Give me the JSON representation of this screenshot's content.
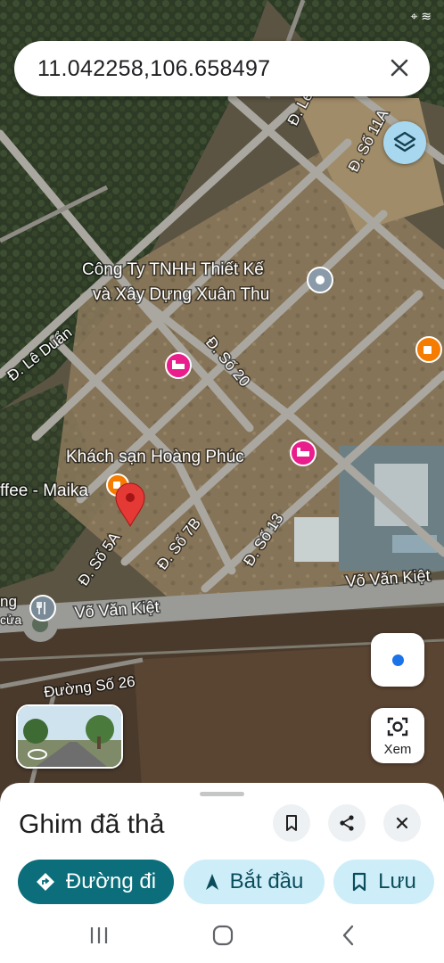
{
  "search": {
    "query": "11.042258,106.658497"
  },
  "map": {
    "labels": {
      "company": [
        "Công Ty TNHH Thiết Kế",
        "và Xây Dựng Xuân Thu"
      ],
      "hotel": "Khách sạn Hoàng Phúc",
      "cafe": "ffee - Maika",
      "restaurant": [
        "ng",
        "cửa"
      ],
      "roads": {
        "le_duan": "Đ. Lê Duẩn",
        "le_top": "Đ. Lê",
        "so_11a": "Đ. Số 11A",
        "so_20": "Đ. Số 20",
        "so_5a": "Đ. Số 5A",
        "so_7b": "Đ. Số 7B",
        "so_13": "Đ. Số 13",
        "vo_van_kiet_right": "Võ Văn Kiệt",
        "vo_van_kiet_left": "Võ Văn Kiệt",
        "duong_so_26": "Đường Số 26"
      }
    },
    "pin_color": "#e53935",
    "hotel_icon_color": "#e91e8c",
    "cafe_icon_color": "#f57c00",
    "location_dot_color": "#1a73e8",
    "xem_label": "Xem"
  },
  "sheet": {
    "title": "Ghim đã thả",
    "directions_label": "Đường đi",
    "start_label": "Bắt đầu",
    "save_label": "Lưu",
    "accent": "#0b6e7a"
  }
}
